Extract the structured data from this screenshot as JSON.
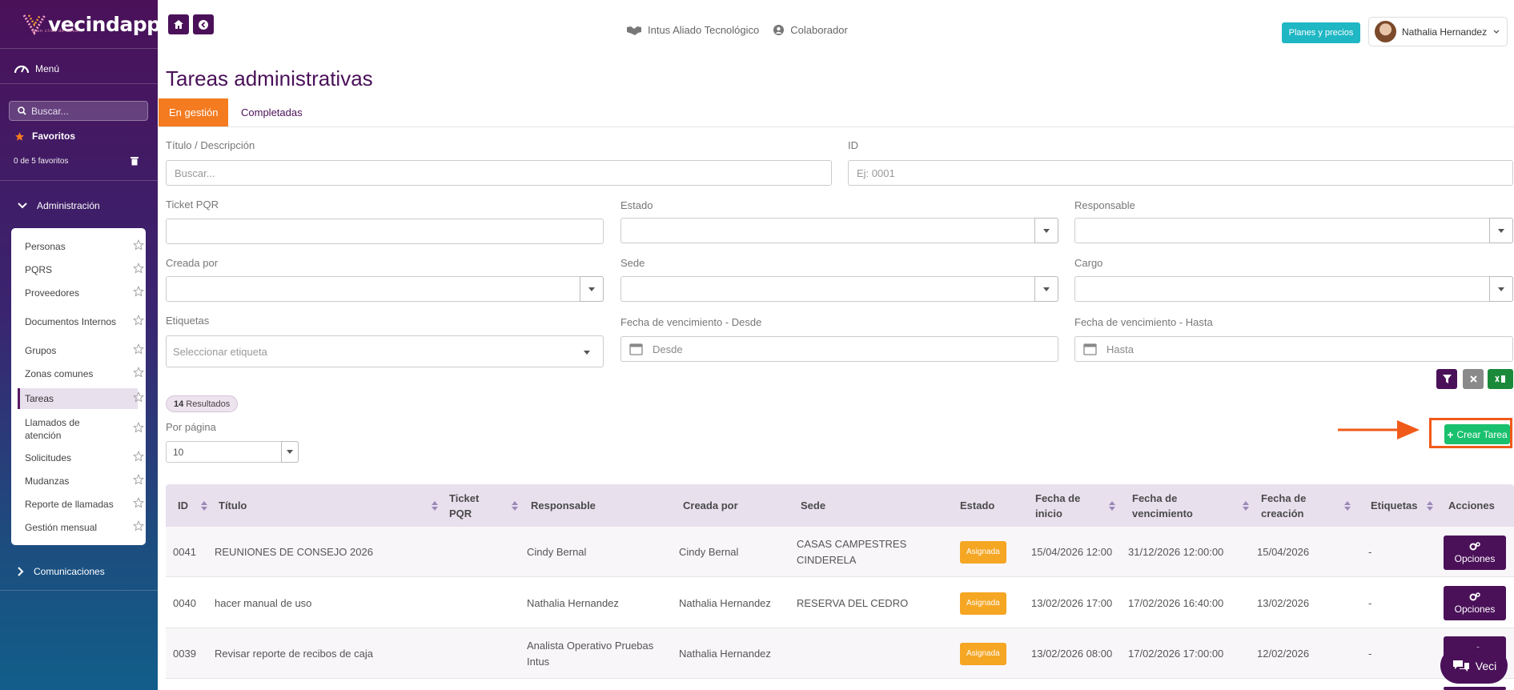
{
  "brand": {
    "name": "vecindapp",
    "tagline": "a un click de casa"
  },
  "sidebar": {
    "menu_label": "Menú",
    "search_placeholder": "Buscar...",
    "favorites_label": "Favoritos",
    "favorites_count": "0 de 5 favoritos",
    "administration_label": "Administración",
    "admin_items": [
      {
        "label": "Personas"
      },
      {
        "label": "PQRS"
      },
      {
        "label": "Proveedores"
      },
      {
        "label": "Documentos Internos"
      },
      {
        "label": "Grupos"
      },
      {
        "label": "Zonas comunes"
      },
      {
        "label": "Tareas",
        "active": true
      },
      {
        "label": "Llamados de atención"
      },
      {
        "label": "Solicitudes"
      },
      {
        "label": "Mudanzas"
      },
      {
        "label": "Reporte de llamadas"
      },
      {
        "label": "Gestión mensual"
      }
    ],
    "communications_label": "Comunicaciones"
  },
  "header": {
    "company": "Intus Aliado Tecnológico",
    "role": "Colaborador",
    "plans_button": "Planes y precios",
    "user_name": "Nathalia Hernandez"
  },
  "page": {
    "title": "Tareas administrativas"
  },
  "tabs": [
    {
      "label": "En gestión",
      "active": true
    },
    {
      "label": "Completadas"
    }
  ],
  "filters": {
    "title_label": "Título / Descripción",
    "title_placeholder": "Buscar...",
    "id_label": "ID",
    "id_placeholder": "Ej: 0001",
    "ticket_label": "Ticket PQR",
    "status_label": "Estado",
    "responsible_label": "Responsable",
    "created_by_label": "Creada por",
    "site_label": "Sede",
    "position_label": "Cargo",
    "tags_label": "Etiquetas",
    "tags_placeholder": "Seleccionar etiqueta",
    "due_from_label": "Fecha de vencimiento - Desde",
    "due_from_placeholder": "Desde",
    "due_to_label": "Fecha de vencimiento - Hasta",
    "due_to_placeholder": "Hasta"
  },
  "results": {
    "count": "14",
    "label": "Resultados"
  },
  "per_page": {
    "label": "Por página",
    "value": "10"
  },
  "create_button": "Crear Tarea",
  "table": {
    "headers": [
      "ID",
      "Título",
      "Ticket PQR",
      "Responsable",
      "Creada por",
      "Sede",
      "Estado",
      "Fecha de inicio",
      "Fecha de vencimiento",
      "Fecha de creación",
      "Etiquetas",
      "Acciones"
    ],
    "rows": [
      {
        "id": "0041",
        "title": "REUNIONES DE CONSEJO 2026",
        "ticket": "",
        "responsible": "Cindy Bernal",
        "created_by": "Cindy Bernal",
        "site": "CASAS CAMPESTRES CINDERELA",
        "status": "Asignada",
        "start": "15/04/2026 12:00",
        "due": "31/12/2026 12:00:00",
        "created": "15/04/2026",
        "tags": "-",
        "action": "Opciones"
      },
      {
        "id": "0040",
        "title": "hacer manual de uso",
        "ticket": "",
        "responsible": "Nathalia Hernandez",
        "created_by": "Nathalia Hernandez",
        "site": "RESERVA DEL CEDRO",
        "status": "Asignada",
        "start": "13/02/2026 17:00",
        "due": "17/02/2026 16:40:00",
        "created": "13/02/2026",
        "tags": "-",
        "action": "Opciones"
      },
      {
        "id": "0039",
        "title": "Revisar reporte de recibos de caja",
        "ticket": "",
        "responsible": "Analista Operativo Pruebas Intus",
        "created_by": "Nathalia Hernandez",
        "site": "",
        "status": "Asignada",
        "start": "13/02/2026 08:00",
        "due": "17/02/2026 17:00:00",
        "created": "12/02/2026",
        "tags": "-",
        "action": "Opciones"
      }
    ]
  },
  "chat": {
    "label": "Veci"
  },
  "colors": {
    "primary": "#4a1159",
    "accent": "#f47b20",
    "success": "#19c06d",
    "info": "#1fb7c4",
    "warning": "#f5a623"
  }
}
